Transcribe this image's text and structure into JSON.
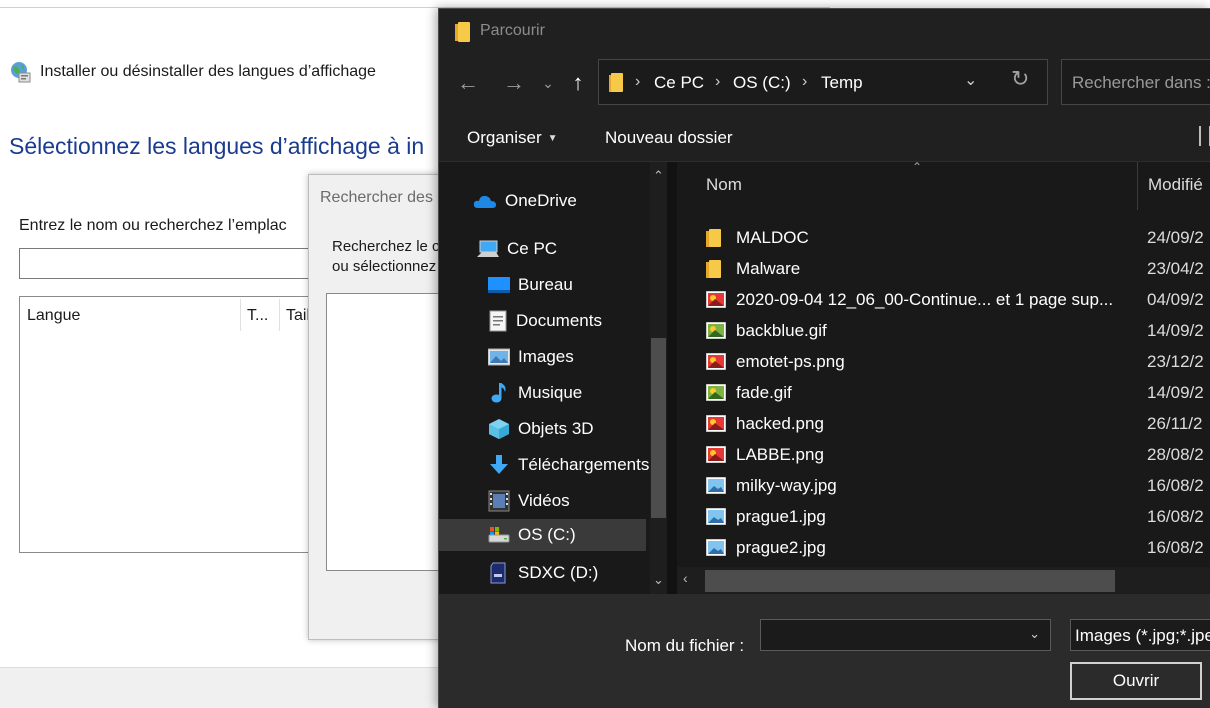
{
  "background_window": {
    "header_title": "Installer ou désinstaller des langues d’affichage",
    "heading": "Sélectionnez les langues d’affichage à in",
    "instruction": "Entrez le nom ou recherchez l’emplac",
    "columns": [
      "Langue",
      "T...",
      "Tail"
    ]
  },
  "middle_dialog": {
    "title": "Rechercher des",
    "text_line1": "Recherchez le c",
    "text_line2": "ou sélectionnez"
  },
  "file_dialog": {
    "title": "Parcourir",
    "address": {
      "segments": [
        "Ce PC",
        "OS (C:)",
        "Temp"
      ]
    },
    "search": {
      "placeholder": "Rechercher dans : Temp"
    },
    "toolbar": {
      "organize": "Organiser",
      "new_folder": "Nouveau dossier"
    },
    "nav_pane": {
      "items": [
        {
          "label": "OneDrive",
          "icon": "onedrive-icon"
        },
        {
          "label": "Ce PC",
          "icon": "computer-icon"
        },
        {
          "label": "Bureau",
          "icon": "desktop-icon"
        },
        {
          "label": "Documents",
          "icon": "documents-icon"
        },
        {
          "label": "Images",
          "icon": "pictures-icon"
        },
        {
          "label": "Musique",
          "icon": "music-icon"
        },
        {
          "label": "Objets 3D",
          "icon": "3d-objects-icon"
        },
        {
          "label": "Téléchargements",
          "icon": "downloads-icon"
        },
        {
          "label": "Vidéos",
          "icon": "videos-icon"
        },
        {
          "label": "OS (C:)",
          "icon": "drive-icon"
        },
        {
          "label": "SDXC (D:)",
          "icon": "sd-card-icon"
        }
      ],
      "selected": "OS (C:)"
    },
    "list": {
      "columns": [
        "Nom",
        "Modifié"
      ],
      "rows": [
        {
          "name": "MALDOC",
          "date": "24/09/2",
          "icon": "folder-icon"
        },
        {
          "name": "Malware",
          "date": "23/04/2",
          "icon": "folder-icon"
        },
        {
          "name": "2020-09-04 12_06_00-Continue... et 1 page sup...",
          "date": "04/09/2",
          "icon": "image-file-icon"
        },
        {
          "name": "backblue.gif",
          "date": "14/09/2",
          "icon": "image-file-icon"
        },
        {
          "name": "emotet-ps.png",
          "date": "23/12/2",
          "icon": "image-file-icon"
        },
        {
          "name": "fade.gif",
          "date": "14/09/2",
          "icon": "image-file-icon"
        },
        {
          "name": "hacked.png",
          "date": "26/11/2",
          "icon": "image-file-icon"
        },
        {
          "name": "LABBE.png",
          "date": "28/08/2",
          "icon": "image-file-icon"
        },
        {
          "name": "milky-way.jpg",
          "date": "16/08/2",
          "icon": "photo-file-icon"
        },
        {
          "name": "prague1.jpg",
          "date": "16/08/2",
          "icon": "photo-file-icon"
        },
        {
          "name": "prague2.jpg",
          "date": "16/08/2",
          "icon": "photo-file-icon"
        }
      ]
    },
    "bottom": {
      "filename_label": "Nom du fichier :",
      "filename_value": "",
      "filter": "Images (*.jpg;*.jpeg;*.png;*.gif)",
      "open_button": "Ouvrir"
    }
  }
}
